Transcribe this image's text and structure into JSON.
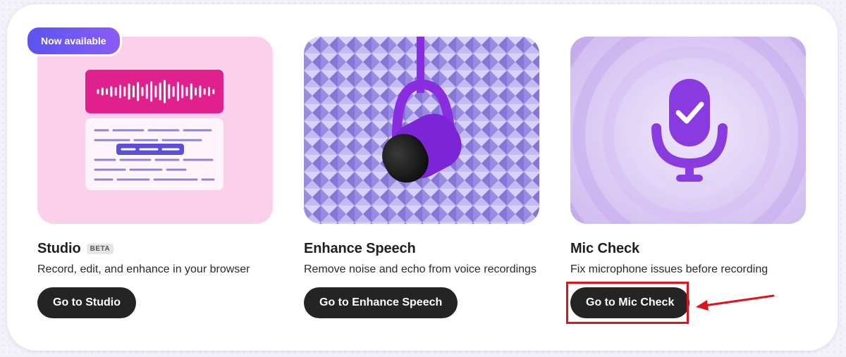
{
  "badge": {
    "label": "Now available"
  },
  "cards": [
    {
      "title": "Studio",
      "tag": "BETA",
      "description": "Record, edit, and enhance in your browser",
      "button_label": "Go to Studio",
      "art": "waveform-transcript-illustration"
    },
    {
      "title": "Enhance Speech",
      "description": "Remove noise and echo from voice recordings",
      "button_label": "Go to Enhance Speech",
      "art": "microphone-acoustic-foam-illustration"
    },
    {
      "title": "Mic Check",
      "description": "Fix microphone issues before recording",
      "button_label": "Go to Mic Check",
      "art": "microphone-checkmark-illustration"
    }
  ],
  "colors": {
    "button_bg": "#242424",
    "badge_gradient_start": "#5a54f0",
    "badge_gradient_end": "#8b5cf6",
    "highlight": "#e0141e",
    "studio_bg": "#fbd0ea",
    "studio_accent": "#e0208c",
    "enhance_bg": "#a89be8",
    "mic_bg": "#dccdf2"
  },
  "annotation": {
    "icon": "red-arrow-icon"
  }
}
